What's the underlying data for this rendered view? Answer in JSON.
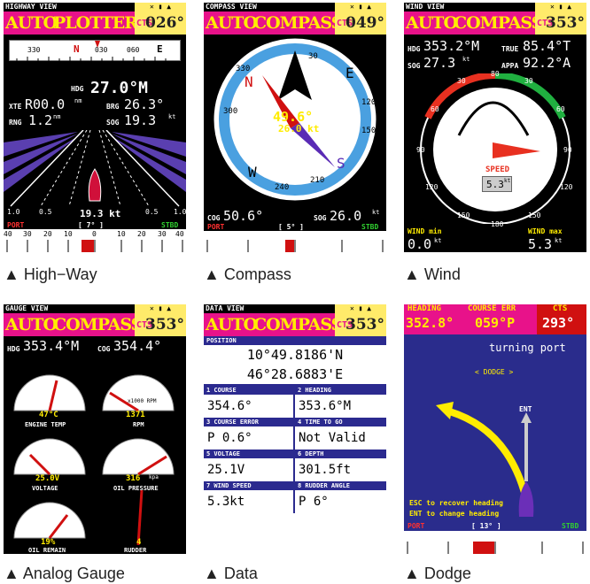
{
  "panels": {
    "highway": {
      "view_title": "HIGHWAY VIEW",
      "mode_left": "AUTO",
      "mode_right": "PLOTTER",
      "cts_label": "CTS",
      "cts_value": "026°",
      "compass_ticks": [
        "330",
        "N",
        "030",
        "060",
        "E"
      ],
      "hdg_label": "HDG",
      "hdg_value": "27.0°M",
      "xte_label": "XTE",
      "xte_value": "R00.0",
      "xte_unit": "nm",
      "brg_label": "BRG",
      "brg_value": "26.3°",
      "rng_label": "RNG",
      "rng_value": "1.2",
      "rng_unit": "nm",
      "sog_label": "SOG",
      "sog_value": "19.3",
      "sog_unit": "kt",
      "speed": "19.3 kt",
      "scale_left": [
        "1.0",
        "0.5"
      ],
      "scale_right": [
        "0.5",
        "1.0"
      ],
      "rudder": "[ 7° ]",
      "port": "PORT",
      "stbd": "STBD",
      "rudder_ticks": [
        "40",
        "30",
        "20",
        "10",
        "0",
        "10",
        "20",
        "30",
        "40"
      ]
    },
    "compass": {
      "view_title": "COMPASS VIEW",
      "mode_left": "AUTO",
      "mode_right": "COMPASS",
      "cts_label": "CTS",
      "cts_value": "049°",
      "dial": [
        "30",
        "E",
        "120",
        "150",
        "S",
        "210",
        "240",
        "W",
        "300",
        "330",
        "N"
      ],
      "heading": "49.6°",
      "speed": "26.0 kt",
      "cog_label": "COG",
      "cog_value": "50.6°",
      "sog_label": "SOG",
      "sog_value": "26.0",
      "sog_unit": "kt",
      "rudder": "[ 5° ]",
      "port": "PORT",
      "stbd": "STBD"
    },
    "wind": {
      "view_title": "WIND VIEW",
      "mode_left": "AUTO",
      "mode_right": "COMPASS",
      "cts_label": "CTS",
      "cts_value": "353°",
      "hdg_label": "HDG",
      "hdg_value": "353.2°M",
      "true_label": "TRUE",
      "true_value": "85.4°T",
      "sog_label": "SOG",
      "sog_value": "27.3",
      "sog_unit": "kt",
      "appa_label": "APPA",
      "appa_value": "92.2°A",
      "dial": [
        "30",
        "60",
        "80",
        "90",
        "120",
        "150",
        "180",
        "150",
        "120",
        "90",
        "60",
        "30"
      ],
      "speed_label": "SPEED",
      "speed_value": "5.3",
      "speed_unit": "kt",
      "wind_min_label": "WIND min",
      "wind_min_value": "0.0",
      "wind_min_unit": "kt",
      "wind_max_label": "WIND max",
      "wind_max_value": "5.3",
      "wind_max_unit": "kt"
    },
    "gauge": {
      "view_title": "GAUGE VIEW",
      "mode_left": "AUTO",
      "mode_right": "COMPASS",
      "cts_label": "CTS",
      "cts_value": "353°",
      "hdg_label": "HDG",
      "hdg_value": "353.4°M",
      "cog_label": "COG",
      "cog_value": "354.4°",
      "gauges": [
        {
          "value": "47°C",
          "label": "ENGINE TEMP"
        },
        {
          "value": "1371",
          "label": "RPM",
          "unit": "x1000 RPM"
        },
        {
          "value": "25.0V",
          "label": "VOLTAGE"
        },
        {
          "value": "316",
          "label": "OIL PRESSURE",
          "unit": "kpa"
        },
        {
          "value": "19%",
          "label": "OIL REMAIN"
        },
        {
          "value": "4",
          "label": "RUDDER"
        }
      ]
    },
    "data": {
      "view_title": "DATA VIEW",
      "mode_left": "AUTO",
      "mode_right": "COMPASS",
      "cts_label": "CTS",
      "cts_value": "353°",
      "position_label": "POSITION",
      "lat": "10°49.8186'N",
      "lon": "46°28.6883'E",
      "cells": [
        {
          "label": "1 COURSE",
          "value": "354.6°"
        },
        {
          "label": "2 HEADING",
          "value": "353.6°M"
        },
        {
          "label": "3 COURSE ERROR",
          "value": "P 0.6°"
        },
        {
          "label": "4 TIME TO GO",
          "value": "Not Valid"
        },
        {
          "label": "5 VOLTAGE",
          "value": "25.1V"
        },
        {
          "label": "6 DEPTH",
          "value": "301.5ft"
        },
        {
          "label": "7 WIND SPEED",
          "value": "5.3kt"
        },
        {
          "label": "8 RUDDER ANGLE",
          "value": "P 6°"
        }
      ]
    },
    "dodge": {
      "heading_label": "HEADING",
      "heading_value": "352.8°",
      "course_err_label": "COURSE ERR",
      "course_err_value": "059°P",
      "cts_label": "CTS",
      "cts_value": "293°",
      "turning": "turning port",
      "dodge": "< DODGE >",
      "ent": "ENT",
      "esc_help": "ESC to recover heading",
      "ent_help": "ENT to change heading",
      "rudder": "[ 13° ]",
      "port": "PORT",
      "stbd": "STBD"
    }
  },
  "captions": [
    "▲ High−Way",
    "▲ Compass",
    "▲ Wind",
    "▲ Analog Gauge",
    "▲ Data",
    "▲ Dodge"
  ]
}
